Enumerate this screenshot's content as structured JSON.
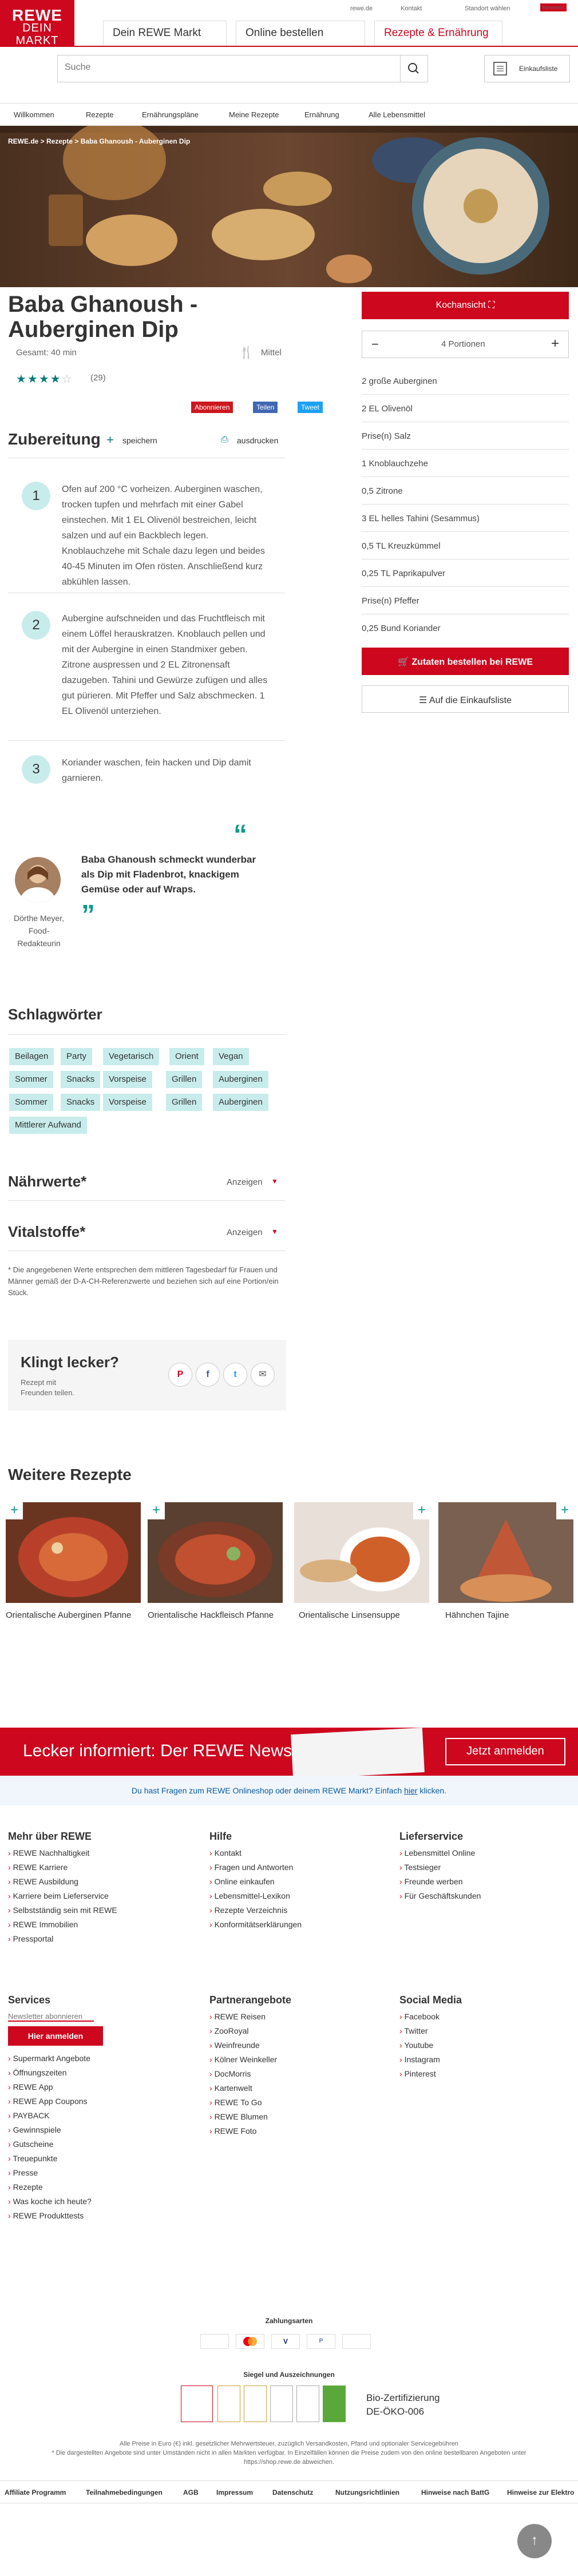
{
  "topbar": {
    "rewe_de": "rewe.de",
    "kontakt": "Kontakt",
    "standort": "Standort wählen",
    "payment_badge": "Kennwort"
  },
  "logo": {
    "line1": "REWE",
    "line2": "DEIN MARKT"
  },
  "tabs": [
    {
      "label": "Dein REWE Markt"
    },
    {
      "label": "Online bestellen"
    },
    {
      "label": "Rezepte & Ernährung"
    }
  ],
  "search": {
    "placeholder": "Suche"
  },
  "cart": {
    "label": "Einkaufsliste"
  },
  "nav": [
    "Willkommen",
    "Rezepte",
    "Ernährungspläne",
    "Meine Rezepte",
    "Ernährung",
    "Alle Lebensmittel"
  ],
  "breadcrumb": "REWE.de > Rezepte > Baba Ghanoush - Auberginen Dip",
  "recipe": {
    "title_line1": "Baba Ghanoush -",
    "title_line2": "Auberginen Dip",
    "time": "Gesamt: 40 min",
    "difficulty": "Mittel",
    "rating_count": "(29)",
    "rating": 4
  },
  "share": {
    "abonnieren": "Abonnieren",
    "teilen": "Teilen",
    "tweet": "Tweet"
  },
  "prep": {
    "heading": "Zubereitung",
    "save": "speichern",
    "print": "ausdrucken"
  },
  "steps": [
    {
      "num": "1",
      "text": "Ofen auf 200 °C vorheizen. Auberginen waschen, trocken tupfen und mehrfach mit einer Gabel einstechen. Mit 1 EL Olivenöl bestreichen, leicht salzen und auf ein Backblech legen. Knoblauchzehe mit Schale dazu legen und beides 40-45 Minuten im Ofen rösten. Anschließend kurz abkühlen lassen."
    },
    {
      "num": "2",
      "text": "Aubergine aufschneiden und das Fruchtfleisch mit einem Löffel herauskratzen. Knoblauch pellen und mit der Aubergine in einen Standmixer geben. Zitrone auspressen und 2 EL Zitronensaft dazugeben. Tahini und Gewürze zufügen und alles gut pürieren. Mit Pfeffer und Salz abschmecken. 1 EL Olivenöl unterziehen."
    },
    {
      "num": "3",
      "text": "Koriander waschen, fein hacken und Dip damit garnieren."
    }
  ],
  "quote": {
    "text": "Baba Ghanoush schmeckt wunderbar als Dip mit Fladenbrot, knackigem Gemüse oder auf Wraps.",
    "author": "Dörthe Meyer, Food-Redakteurin"
  },
  "tags_heading": "Schlagwörter",
  "tags": [
    [
      "Beilagen",
      "Party",
      "Vegetarisch",
      "Orient",
      "Vegan"
    ],
    [
      "Sommer",
      "Snacks",
      "Vorspeise",
      "Grillen",
      "Auberginen"
    ],
    [
      "Sommer",
      "Snacks",
      "Vorspeise",
      "Grillen",
      "Auberginen"
    ],
    [
      "Mittlerer Aufwand"
    ]
  ],
  "naehrwerte": {
    "heading": "Nährwerte*",
    "toggle": "Anzeigen"
  },
  "vitalstoffe": {
    "heading": "Vitalstoffe*",
    "toggle": "Anzeigen"
  },
  "footnote": "* Die angegebenen Werte entsprechen dem mittleren Tagesbedarf für Frauen und Männer gemäß der D-A-CH-Referenzwerte und beziehen sich auf eine Portion/ein Stück.",
  "klingt": {
    "heading": "Klingt lecker?",
    "sub": "Rezept mit Freunden teilen."
  },
  "sidebar": {
    "kochansicht": "Kochansicht",
    "portions": "4 Portionen",
    "minus": "−",
    "plus": "+",
    "order": "Zutaten bestellen bei",
    "order_brand": "REWE",
    "list": "Auf die Einkaufsliste"
  },
  "ingredients": [
    "2 große Auberginen",
    "2 EL Olivenöl",
    "Prise(n) Salz",
    "1 Knoblauchzehe",
    "0,5 Zitrone",
    "3 EL helles Tahini (Sesammus)",
    "0,5 TL Kreuzkümmel",
    "0,25 TL Paprikapulver",
    "Prise(n) Pfeffer",
    "0,25 Bund Koriander"
  ],
  "more": {
    "heading": "Weitere Rezepte",
    "items": [
      "Orientalische Auberginen Pfanne",
      "Orientalische Hackfleisch Pfanne",
      "Orientalische Linsensuppe",
      "Hähnchen Tajine"
    ]
  },
  "newsletter": {
    "banner": "Lecker informiert: Der REWE Newsletter",
    "cta": "Jetzt anmelden",
    "info_pre": "Du hast Fragen zum REWE Onlineshop oder deinem REWE Markt? Einfach ",
    "info_link": "hier",
    "info_post": " klicken."
  },
  "footer": {
    "mehr": {
      "h": "Mehr über REWE",
      "items": [
        "REWE Nachhaltigkeit",
        "REWE Karriere",
        "REWE Ausbildung",
        "Karriere beim Lieferservice",
        "Selbstständig sein mit REWE",
        "REWE Immobilien",
        "Pressportal"
      ]
    },
    "hilfe": {
      "h": "Hilfe",
      "items": [
        "Kontakt",
        "Fragen und Antworten",
        "Online einkaufen",
        "Lebensmittel-Lexikon",
        "Rezepte Verzeichnis",
        "Konformitätserklärungen"
      ]
    },
    "liefer": {
      "h": "Lieferservice",
      "items": [
        "Lebensmittel Online",
        "Testsieger",
        "Freunde werben",
        "Für Geschäftskunden"
      ]
    },
    "services": {
      "h": "Services",
      "nl": "Newsletter abonnieren",
      "btn": "Hier anmelden",
      "items": [
        "Supermarkt Angebote",
        "Öffnungszeiten",
        "REWE App",
        "REWE App Coupons",
        "PAYBACK",
        "Gewinnspiele",
        "Gutscheine",
        "Treuepunkte",
        "Presse",
        "Rezepte",
        "Was koche ich heute?",
        "REWE Produkttests"
      ]
    },
    "partner": {
      "h": "Partnerangebote",
      "items": [
        "REWE Reisen",
        "ZooRoyal",
        "Weinfreunde",
        "Kölner Weinkeller",
        "DocMorris",
        "Kartenwelt",
        "REWE To Go",
        "REWE Blumen",
        "REWE Foto"
      ]
    },
    "social": {
      "h": "Social Media",
      "items": [
        "Facebook",
        "Twitter",
        "Youtube",
        "Instagram",
        "Pinterest"
      ]
    },
    "zahlung": "Zahlungsarten",
    "siegel": "Siegel und Auszeichnungen",
    "bio1": "Bio-Zertifizierung",
    "bio2": "DE-ÖKO-006",
    "legal1": "Alle Preise in Euro (€) inkl. gesetzlicher Mehrwertsteuer, zuzüglich Versandkosten, Pfand und optionaler Servicegebühren",
    "legal2": "* Die dargestellten Angebote sind unter Umständen nicht in allen Märkten verfügbar. In Einzelfällen können die Preise zudem von den online bestellbaren Angeboten unter https://shop.rewe.de abweichen.",
    "bottom": [
      "Affiliate Programm",
      "Teilnahmebedingungen",
      "AGB",
      "Impressum",
      "Datenschutz",
      "Nutzungsrichtlinien",
      "Hinweise nach BattG",
      "Hinweise zur Elektro"
    ]
  },
  "colors": {
    "red": "#cc071e",
    "teal": "#c8ecec"
  }
}
